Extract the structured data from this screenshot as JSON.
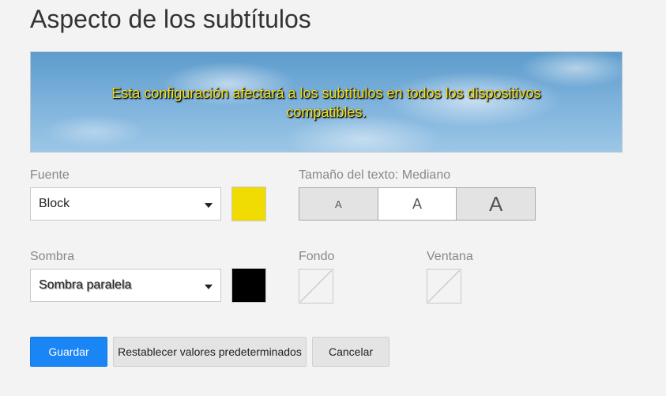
{
  "page": {
    "title": "Aspecto de los subtítulos"
  },
  "preview": {
    "text": "Esta configuración afectará a los subtítulos en todos los dispositivos compatibles.",
    "text_color": "#f0dc1a"
  },
  "font": {
    "label": "Fuente",
    "value": "Block",
    "color": "#f0dc1a"
  },
  "text_size": {
    "label": "Tamaño del texto: Mediano",
    "options": [
      "A",
      "A",
      "A"
    ],
    "selected_index": 1
  },
  "shadow": {
    "label": "Sombra",
    "value": "Sombra paralela",
    "color": "#000000"
  },
  "background": {
    "label": "Fondo"
  },
  "window": {
    "label": "Ventana"
  },
  "actions": {
    "save": "Guardar",
    "reset": "Restablecer valores predeterminados",
    "cancel": "Cancelar"
  }
}
